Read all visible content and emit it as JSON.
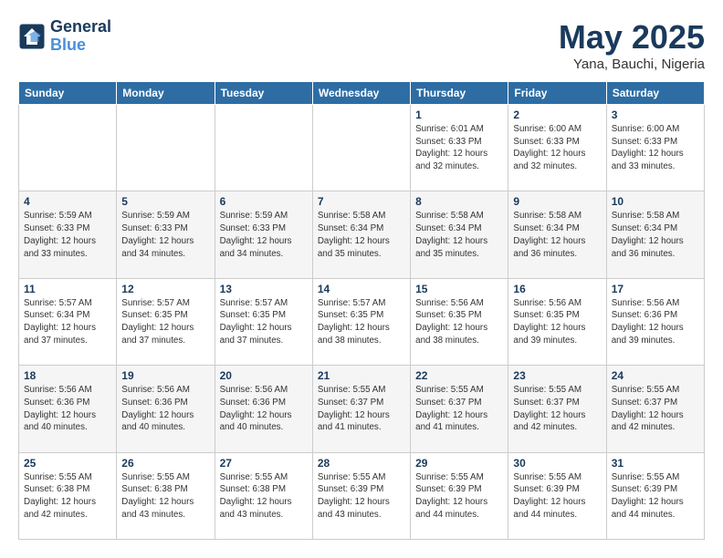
{
  "header": {
    "logo_line1": "General",
    "logo_line2": "Blue",
    "month": "May 2025",
    "location": "Yana, Bauchi, Nigeria"
  },
  "weekdays": [
    "Sunday",
    "Monday",
    "Tuesday",
    "Wednesday",
    "Thursday",
    "Friday",
    "Saturday"
  ],
  "weeks": [
    [
      {
        "day": "",
        "sunrise": "",
        "sunset": "",
        "daylight": ""
      },
      {
        "day": "",
        "sunrise": "",
        "sunset": "",
        "daylight": ""
      },
      {
        "day": "",
        "sunrise": "",
        "sunset": "",
        "daylight": ""
      },
      {
        "day": "",
        "sunrise": "",
        "sunset": "",
        "daylight": ""
      },
      {
        "day": "1",
        "sunrise": "Sunrise: 6:01 AM",
        "sunset": "Sunset: 6:33 PM",
        "daylight": "Daylight: 12 hours and 32 minutes."
      },
      {
        "day": "2",
        "sunrise": "Sunrise: 6:00 AM",
        "sunset": "Sunset: 6:33 PM",
        "daylight": "Daylight: 12 hours and 32 minutes."
      },
      {
        "day": "3",
        "sunrise": "Sunrise: 6:00 AM",
        "sunset": "Sunset: 6:33 PM",
        "daylight": "Daylight: 12 hours and 33 minutes."
      }
    ],
    [
      {
        "day": "4",
        "sunrise": "Sunrise: 5:59 AM",
        "sunset": "Sunset: 6:33 PM",
        "daylight": "Daylight: 12 hours and 33 minutes."
      },
      {
        "day": "5",
        "sunrise": "Sunrise: 5:59 AM",
        "sunset": "Sunset: 6:33 PM",
        "daylight": "Daylight: 12 hours and 34 minutes."
      },
      {
        "day": "6",
        "sunrise": "Sunrise: 5:59 AM",
        "sunset": "Sunset: 6:33 PM",
        "daylight": "Daylight: 12 hours and 34 minutes."
      },
      {
        "day": "7",
        "sunrise": "Sunrise: 5:58 AM",
        "sunset": "Sunset: 6:34 PM",
        "daylight": "Daylight: 12 hours and 35 minutes."
      },
      {
        "day": "8",
        "sunrise": "Sunrise: 5:58 AM",
        "sunset": "Sunset: 6:34 PM",
        "daylight": "Daylight: 12 hours and 35 minutes."
      },
      {
        "day": "9",
        "sunrise": "Sunrise: 5:58 AM",
        "sunset": "Sunset: 6:34 PM",
        "daylight": "Daylight: 12 hours and 36 minutes."
      },
      {
        "day": "10",
        "sunrise": "Sunrise: 5:58 AM",
        "sunset": "Sunset: 6:34 PM",
        "daylight": "Daylight: 12 hours and 36 minutes."
      }
    ],
    [
      {
        "day": "11",
        "sunrise": "Sunrise: 5:57 AM",
        "sunset": "Sunset: 6:34 PM",
        "daylight": "Daylight: 12 hours and 37 minutes."
      },
      {
        "day": "12",
        "sunrise": "Sunrise: 5:57 AM",
        "sunset": "Sunset: 6:35 PM",
        "daylight": "Daylight: 12 hours and 37 minutes."
      },
      {
        "day": "13",
        "sunrise": "Sunrise: 5:57 AM",
        "sunset": "Sunset: 6:35 PM",
        "daylight": "Daylight: 12 hours and 37 minutes."
      },
      {
        "day": "14",
        "sunrise": "Sunrise: 5:57 AM",
        "sunset": "Sunset: 6:35 PM",
        "daylight": "Daylight: 12 hours and 38 minutes."
      },
      {
        "day": "15",
        "sunrise": "Sunrise: 5:56 AM",
        "sunset": "Sunset: 6:35 PM",
        "daylight": "Daylight: 12 hours and 38 minutes."
      },
      {
        "day": "16",
        "sunrise": "Sunrise: 5:56 AM",
        "sunset": "Sunset: 6:35 PM",
        "daylight": "Daylight: 12 hours and 39 minutes."
      },
      {
        "day": "17",
        "sunrise": "Sunrise: 5:56 AM",
        "sunset": "Sunset: 6:36 PM",
        "daylight": "Daylight: 12 hours and 39 minutes."
      }
    ],
    [
      {
        "day": "18",
        "sunrise": "Sunrise: 5:56 AM",
        "sunset": "Sunset: 6:36 PM",
        "daylight": "Daylight: 12 hours and 40 minutes."
      },
      {
        "day": "19",
        "sunrise": "Sunrise: 5:56 AM",
        "sunset": "Sunset: 6:36 PM",
        "daylight": "Daylight: 12 hours and 40 minutes."
      },
      {
        "day": "20",
        "sunrise": "Sunrise: 5:56 AM",
        "sunset": "Sunset: 6:36 PM",
        "daylight": "Daylight: 12 hours and 40 minutes."
      },
      {
        "day": "21",
        "sunrise": "Sunrise: 5:55 AM",
        "sunset": "Sunset: 6:37 PM",
        "daylight": "Daylight: 12 hours and 41 minutes."
      },
      {
        "day": "22",
        "sunrise": "Sunrise: 5:55 AM",
        "sunset": "Sunset: 6:37 PM",
        "daylight": "Daylight: 12 hours and 41 minutes."
      },
      {
        "day": "23",
        "sunrise": "Sunrise: 5:55 AM",
        "sunset": "Sunset: 6:37 PM",
        "daylight": "Daylight: 12 hours and 42 minutes."
      },
      {
        "day": "24",
        "sunrise": "Sunrise: 5:55 AM",
        "sunset": "Sunset: 6:37 PM",
        "daylight": "Daylight: 12 hours and 42 minutes."
      }
    ],
    [
      {
        "day": "25",
        "sunrise": "Sunrise: 5:55 AM",
        "sunset": "Sunset: 6:38 PM",
        "daylight": "Daylight: 12 hours and 42 minutes."
      },
      {
        "day": "26",
        "sunrise": "Sunrise: 5:55 AM",
        "sunset": "Sunset: 6:38 PM",
        "daylight": "Daylight: 12 hours and 43 minutes."
      },
      {
        "day": "27",
        "sunrise": "Sunrise: 5:55 AM",
        "sunset": "Sunset: 6:38 PM",
        "daylight": "Daylight: 12 hours and 43 minutes."
      },
      {
        "day": "28",
        "sunrise": "Sunrise: 5:55 AM",
        "sunset": "Sunset: 6:39 PM",
        "daylight": "Daylight: 12 hours and 43 minutes."
      },
      {
        "day": "29",
        "sunrise": "Sunrise: 5:55 AM",
        "sunset": "Sunset: 6:39 PM",
        "daylight": "Daylight: 12 hours and 44 minutes."
      },
      {
        "day": "30",
        "sunrise": "Sunrise: 5:55 AM",
        "sunset": "Sunset: 6:39 PM",
        "daylight": "Daylight: 12 hours and 44 minutes."
      },
      {
        "day": "31",
        "sunrise": "Sunrise: 5:55 AM",
        "sunset": "Sunset: 6:39 PM",
        "daylight": "Daylight: 12 hours and 44 minutes."
      }
    ]
  ]
}
